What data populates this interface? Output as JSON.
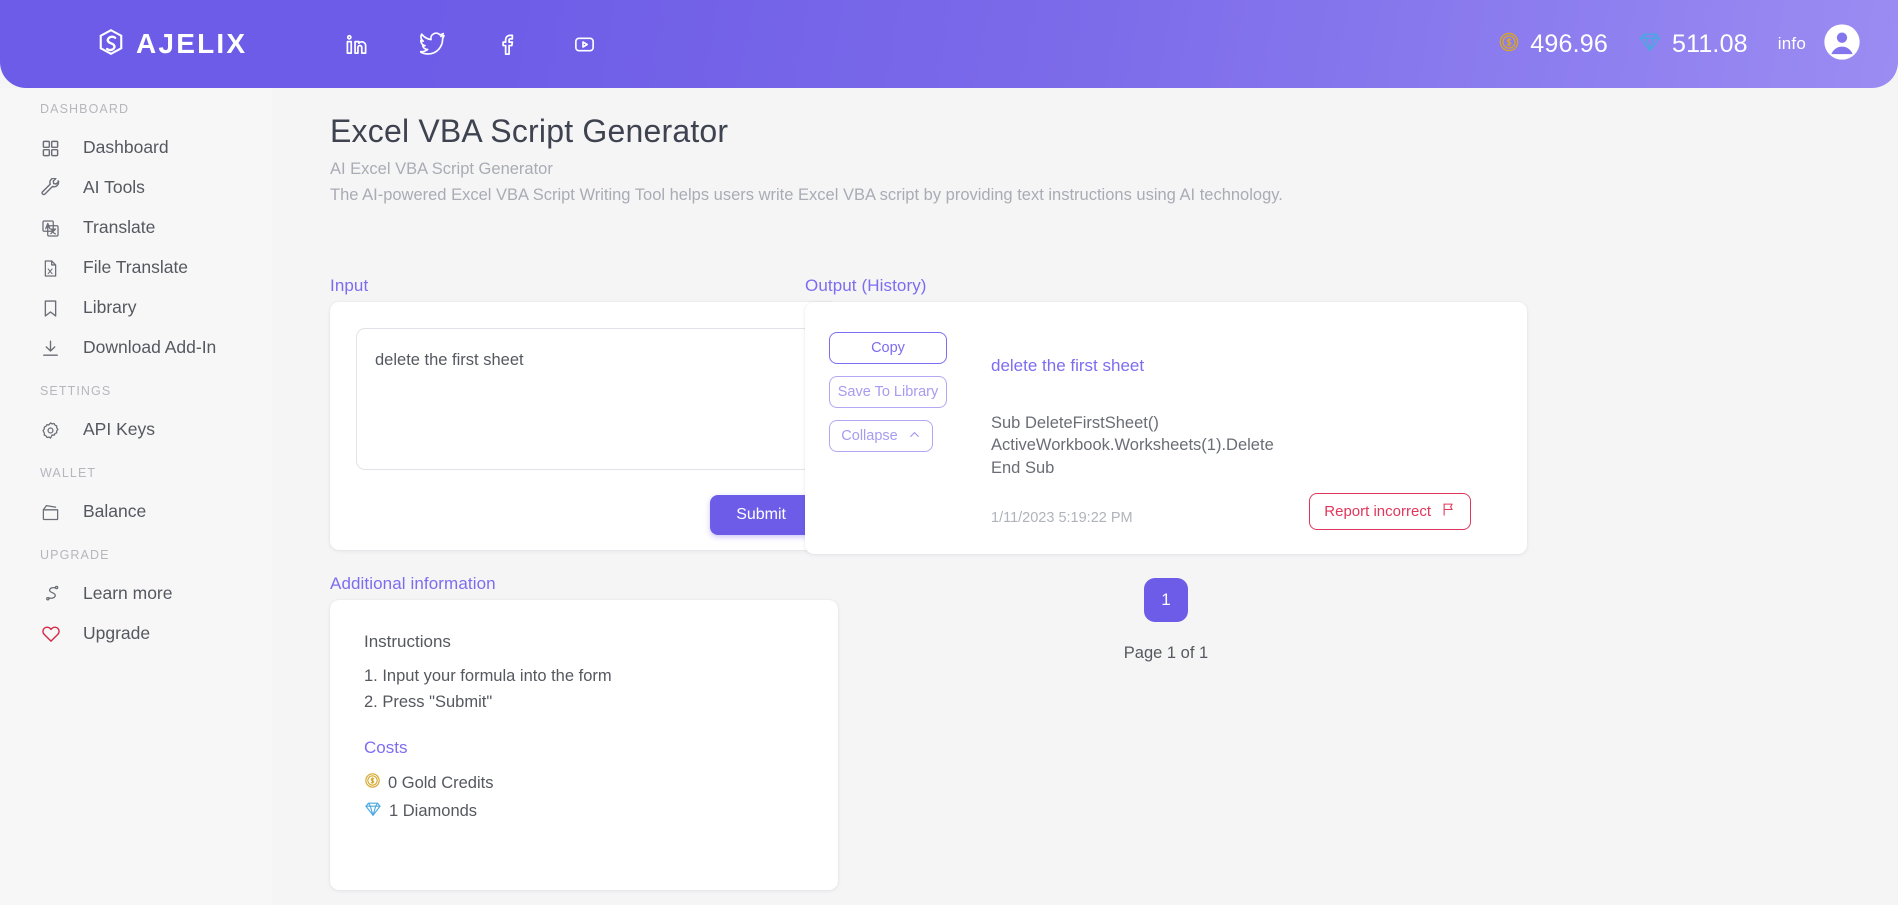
{
  "header": {
    "logo_text": "AJELIX",
    "logo_icon": "ajelix-swirl-icon",
    "social": [
      {
        "name": "linkedin-icon",
        "label": "LinkedIn"
      },
      {
        "name": "twitter-icon",
        "label": "Twitter"
      },
      {
        "name": "facebook-icon",
        "label": "Facebook"
      },
      {
        "name": "youtube-icon",
        "label": "YouTube"
      }
    ],
    "gold_credits": "496.96",
    "diamonds": "511.08",
    "info_label": "info",
    "accent": "#6c5ce7",
    "gold_color": "#d7a62a",
    "diamond_color": "#4aa8e0"
  },
  "sidebar": {
    "sections": [
      {
        "title": "DASHBOARD",
        "items": [
          {
            "label": "Dashboard",
            "icon": "grid-icon"
          },
          {
            "label": "AI Tools",
            "icon": "wrench-icon"
          },
          {
            "label": "Translate",
            "icon": "translate-icon"
          },
          {
            "label": "File Translate",
            "icon": "file-excel-icon"
          },
          {
            "label": "Library",
            "icon": "bookmark-icon"
          },
          {
            "label": "Download Add-In",
            "icon": "download-icon"
          }
        ]
      },
      {
        "title": "SETTINGS",
        "items": [
          {
            "label": "API Keys",
            "icon": "gear-icon"
          }
        ]
      },
      {
        "title": "WALLET",
        "items": [
          {
            "label": "Balance",
            "icon": "wallet-icon"
          }
        ]
      },
      {
        "title": "UPGRADE",
        "items": [
          {
            "label": "Learn more",
            "icon": "path-icon"
          },
          {
            "label": "Upgrade",
            "icon": "heart-icon"
          }
        ]
      }
    ]
  },
  "page": {
    "title": "Excel VBA Script Generator",
    "subtitle": "AI Excel VBA Script Generator",
    "description": "The AI-powered Excel VBA Script Writing Tool helps users write Excel VBA script by providing text instructions using AI technology."
  },
  "input": {
    "label": "Input",
    "value": "delete the first sheet",
    "placeholder": "",
    "submit_label": "Submit"
  },
  "additional": {
    "label": "Additional information",
    "instructions_head": "Instructions",
    "instructions": [
      "1. Input your formula into the form",
      "2. Press \"Submit\""
    ],
    "costs_head": "Costs",
    "costs": [
      {
        "icon": "gold-coin-icon",
        "text": "0 Gold Credits"
      },
      {
        "icon": "diamond-icon",
        "text": "1 Diamonds"
      }
    ]
  },
  "output": {
    "label": "Output (History)",
    "buttons": {
      "copy": "Copy",
      "save": "Save To Library",
      "collapse": "Collapse"
    },
    "entry": {
      "title": "delete the first sheet",
      "code_lines": [
        "Sub DeleteFirstSheet()",
        "ActiveWorkbook.Worksheets(1).Delete",
        "End Sub"
      ],
      "timestamp": "1/11/2023 5:19:22 PM",
      "report_label": "Report incorrect"
    }
  },
  "pagination": {
    "current_page": "1",
    "status": "Page 1 of 1"
  }
}
